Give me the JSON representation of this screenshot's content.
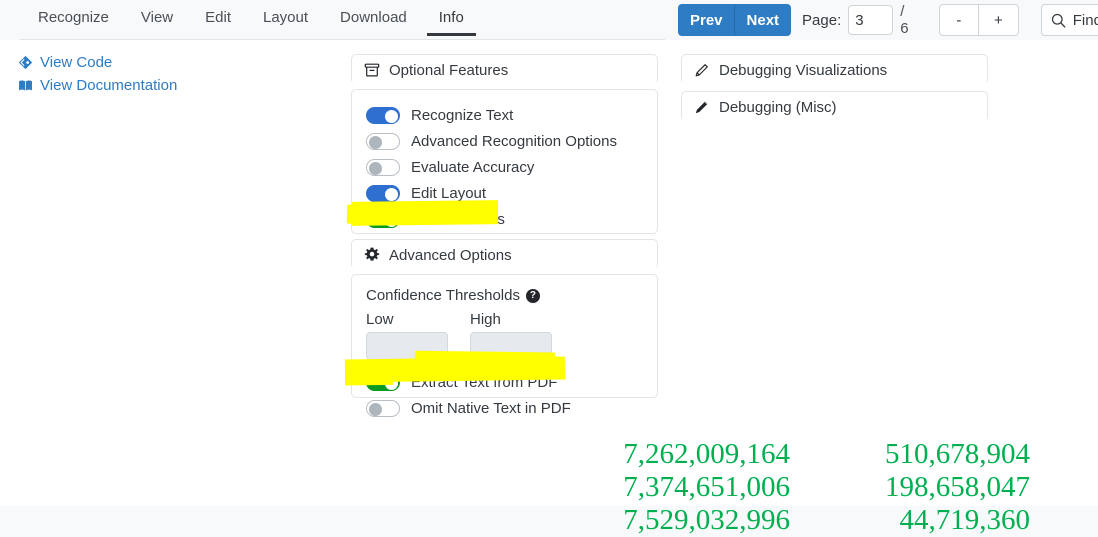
{
  "nav": {
    "tabs": [
      {
        "label": "Recognize",
        "active": false
      },
      {
        "label": "View",
        "active": false
      },
      {
        "label": "Edit",
        "active": false
      },
      {
        "label": "Layout",
        "active": false
      },
      {
        "label": "Download",
        "active": false
      },
      {
        "label": "Info",
        "active": true
      }
    ]
  },
  "pager": {
    "prev_label": "Prev",
    "next_label": "Next",
    "page_label": "Page:",
    "page_value": "3",
    "page_total": "/ 6",
    "zoom_out_label": "-",
    "zoom_in_label": "+",
    "find_label": "Find",
    "find_icon": "search-icon"
  },
  "sidebar": {
    "links": [
      {
        "label": "View Code",
        "icon": "code-diamond-icon"
      },
      {
        "label": "View Documentation",
        "icon": "book-icon"
      }
    ]
  },
  "panels": {
    "optional_features": {
      "title": "Optional Features",
      "icon": "archive-box-icon",
      "toggles": [
        {
          "label": "Recognize Text",
          "state": "on",
          "color": "blue",
          "highlighted": false
        },
        {
          "label": "Advanced Recognition Options",
          "state": "off",
          "color": "gray",
          "highlighted": false
        },
        {
          "label": "Evaluate Accuracy",
          "state": "off",
          "color": "gray",
          "highlighted": false
        },
        {
          "label": "Edit Layout",
          "state": "on",
          "color": "blue",
          "highlighted": false
        },
        {
          "label": "Extract Tables",
          "state": "on",
          "color": "green",
          "highlighted": true
        }
      ]
    },
    "advanced_options": {
      "title": "Advanced Options",
      "icon": "gear-icon",
      "confidence": {
        "title": "Confidence Thresholds",
        "help_icon": "help-circle-icon",
        "help_glyph": "?",
        "low_label": "Low",
        "low_value": "",
        "high_label": "High",
        "high_value": ""
      },
      "toggles": [
        {
          "label": "Extract Text from PDF",
          "state": "on",
          "color": "green",
          "highlighted": true
        },
        {
          "label": "Omit Native Text in PDF",
          "state": "off",
          "color": "gray",
          "highlighted": false
        }
      ]
    },
    "debugging_visualizations": {
      "title": "Debugging Visualizations",
      "icon": "pencil-icon"
    },
    "debugging_misc": {
      "title": "Debugging (Misc)",
      "icon": "pencil-icon"
    }
  },
  "document": {
    "numbers_left": [
      "7,262,009,164",
      "7,374,651,006",
      "7,529,032,996"
    ],
    "numbers_right": [
      "510,678,904",
      "198,658,047",
      "44,719,360"
    ],
    "number_color": "#00b050"
  },
  "colors": {
    "accent_blue": "#2e7cc4",
    "toggle_blue": "#2f6fd0",
    "toggle_green": "#0a9a22",
    "highlight_yellow": "#ffff00",
    "page_bg": "#f8f9fa"
  }
}
